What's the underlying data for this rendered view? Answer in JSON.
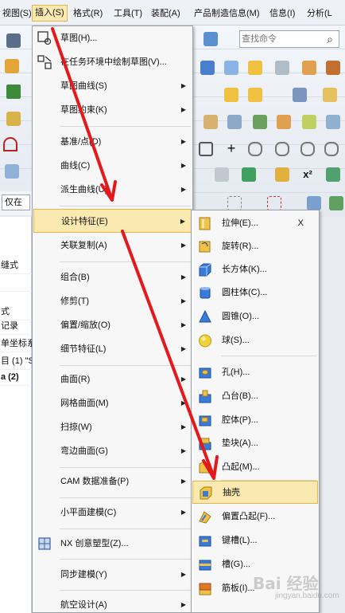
{
  "menubar": {
    "items": [
      {
        "label": "视图(S)",
        "active": false
      },
      {
        "label": "插入(S)",
        "active": true
      },
      {
        "label": "格式(R)",
        "active": false
      },
      {
        "label": "工具(T)",
        "active": false
      },
      {
        "label": "装配(A)",
        "active": false
      },
      {
        "label": "产品制造信息(M)",
        "active": false
      },
      {
        "label": "信息(I)",
        "active": false
      },
      {
        "label": "分析(L",
        "active": false
      }
    ]
  },
  "search": {
    "placeholder": "查找命令"
  },
  "left_panel": {
    "filter_text": "仅在",
    "rows": [
      "缝式",
      "",
      "式",
      "记录",
      "单坐标系",
      "目 (1) \"S",
      "a (2)"
    ]
  },
  "insert_menu": {
    "items": [
      {
        "label": "草图(H)...",
        "icon": "sketch-icon",
        "submenu": false
      },
      {
        "label": "在任务环境中绘制草图(V)...",
        "icon": "sketch-task-icon",
        "submenu": false
      },
      {
        "label": "草图曲线(S)",
        "icon": "",
        "submenu": true
      },
      {
        "label": "草图约束(K)",
        "icon": "",
        "submenu": true
      },
      {
        "label": "基准/点(D)",
        "icon": "",
        "submenu": true
      },
      {
        "label": "曲线(C)",
        "icon": "",
        "submenu": true
      },
      {
        "label": "派生曲线(U)",
        "icon": "",
        "submenu": true
      },
      {
        "label": "设计特征(E)",
        "icon": "",
        "submenu": true
      },
      {
        "label": "关联复制(A)",
        "icon": "",
        "submenu": true
      },
      {
        "label": "组合(B)",
        "icon": "",
        "submenu": true
      },
      {
        "label": "修剪(T)",
        "icon": "",
        "submenu": true
      },
      {
        "label": "偏置/缩放(O)",
        "icon": "",
        "submenu": true
      },
      {
        "label": "细节特征(L)",
        "icon": "",
        "submenu": true
      },
      {
        "label": "曲面(R)",
        "icon": "",
        "submenu": true
      },
      {
        "label": "网格曲面(M)",
        "icon": "",
        "submenu": true
      },
      {
        "label": "扫掠(W)",
        "icon": "",
        "submenu": true
      },
      {
        "label": "弯边曲面(G)",
        "icon": "",
        "submenu": true
      },
      {
        "label": "CAM 数据准备(P)",
        "icon": "",
        "submenu": true
      },
      {
        "label": "小平面建模(C)",
        "icon": "",
        "submenu": true
      },
      {
        "label": "NX 创意塑型(Z)...",
        "icon": "nx-realize-shape-icon",
        "submenu": false
      },
      {
        "label": "同步建模(Y)",
        "icon": "",
        "submenu": true
      },
      {
        "label": "航空设计(A)",
        "icon": "",
        "submenu": true
      }
    ]
  },
  "design_feature_menu": {
    "items": [
      {
        "label": "拉伸(E)...",
        "shortcut": "X",
        "icon": "extrude-icon"
      },
      {
        "label": "旋转(R)...",
        "shortcut": "",
        "icon": "revolve-icon"
      },
      {
        "label": "长方体(K)...",
        "shortcut": "",
        "icon": "block-icon"
      },
      {
        "label": "圆柱体(C)...",
        "shortcut": "",
        "icon": "cylinder-icon"
      },
      {
        "label": "圆锥(O)...",
        "shortcut": "",
        "icon": "cone-icon"
      },
      {
        "label": "球(S)...",
        "shortcut": "",
        "icon": "sphere-icon"
      },
      {
        "label": "孔(H)...",
        "shortcut": "",
        "icon": "hole-icon"
      },
      {
        "label": "凸台(B)...",
        "shortcut": "",
        "icon": "boss-icon"
      },
      {
        "label": "腔体(P)...",
        "shortcut": "",
        "icon": "pocket-icon"
      },
      {
        "label": "垫块(A)...",
        "shortcut": "",
        "icon": "pad-icon"
      },
      {
        "label": "凸起(M)...",
        "shortcut": "",
        "icon": "emboss-icon"
      },
      {
        "label": "抽壳",
        "shortcut": "",
        "icon": "shell-icon"
      },
      {
        "label": "偏置凸起(F)...",
        "shortcut": "",
        "icon": "offset-emboss-icon"
      },
      {
        "label": "键槽(L)...",
        "shortcut": "",
        "icon": "slot-icon"
      },
      {
        "label": "槽(G)...",
        "shortcut": "",
        "icon": "groove-icon"
      },
      {
        "label": "筋板(I)...",
        "shortcut": "",
        "icon": "rib-icon"
      }
    ]
  },
  "colors": {
    "highlight": "#fbe9b2",
    "highlight_border": "#e3b54a",
    "arrow": "#e3191c"
  },
  "watermark": {
    "text": "Bai 经验",
    "sub": "jingyan.baidu.com"
  }
}
